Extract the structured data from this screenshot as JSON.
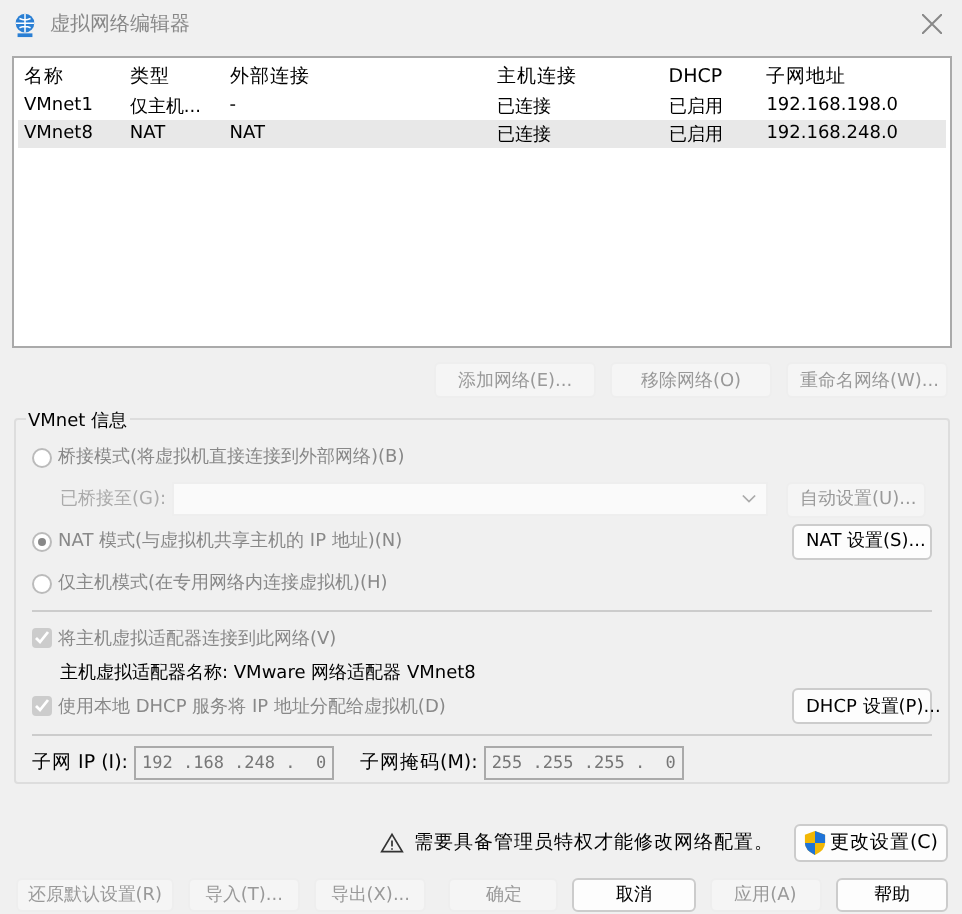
{
  "window": {
    "title": "虚拟网络编辑器"
  },
  "table": {
    "columns": [
      "名称",
      "类型",
      "外部连接",
      "主机连接",
      "DHCP",
      "子网地址"
    ],
    "rows": [
      {
        "cells": [
          "VMnet1",
          "仅主机...",
          "-",
          "已连接",
          "已启用",
          "192.168.198.0"
        ],
        "selected": false
      },
      {
        "cells": [
          "VMnet8",
          "NAT",
          "NAT",
          "已连接",
          "已启用",
          "192.168.248.0"
        ],
        "selected": true
      }
    ]
  },
  "network_buttons": [
    {
      "label": "添加网络(E)...",
      "disabled": true
    },
    {
      "label": "移除网络(O)",
      "disabled": true
    },
    {
      "label": "重命名网络(W)...",
      "disabled": true
    }
  ],
  "vmnet_info": {
    "title": "VMnet 信息",
    "bridged": {
      "label": "桥接模式(将虚拟机直接连接到外部网络)(B)",
      "selected": false,
      "disabled": true
    },
    "bridged_to": {
      "label": "已桥接至(G):",
      "disabled": true,
      "button": {
        "label": "自动设置(U)...",
        "disabled": true
      }
    },
    "nat": {
      "label": "NAT 模式(与虚拟机共享主机的 IP 地址)(N)",
      "selected": true,
      "disabled": true,
      "button": {
        "label": "NAT 设置(S)...",
        "disabled": false
      }
    },
    "host_only": {
      "label": "仅主机模式(在专用网络内连接虚拟机)(H)",
      "selected": false,
      "disabled": true
    },
    "connect_adapter": {
      "label": "将主机虚拟适配器连接到此网络(V)",
      "checked": true,
      "disabled": true
    },
    "adapter_name": "主机虚拟适配器名称: VMware 网络适配器 VMnet8",
    "use_dhcp": {
      "label": "使用本地 DHCP 服务将 IP 地址分配给虚拟机(D)",
      "checked": true,
      "disabled": true,
      "button": {
        "label": "DHCP 设置(P)...",
        "disabled": false
      }
    },
    "subnet_ip": {
      "label": "子网 IP (I):",
      "value": "192 .168 .248 .  0"
    },
    "subnet_mask": {
      "label": "子网掩码(M):",
      "value": "255 .255 .255 .  0"
    }
  },
  "notice": {
    "text": "需要具备管理员特权才能修改网络配置。",
    "button": "更改设置(C)"
  },
  "footer_buttons": [
    {
      "label": "还原默认设置(R)",
      "disabled": true
    },
    {
      "label": "导入(T)...",
      "disabled": true
    },
    {
      "label": "导出(X)...",
      "disabled": true
    },
    {
      "label": "确定",
      "disabled": true
    },
    {
      "label": "取消",
      "disabled": false
    },
    {
      "label": "应用(A)",
      "disabled": true
    },
    {
      "label": "帮助",
      "disabled": false
    }
  ]
}
